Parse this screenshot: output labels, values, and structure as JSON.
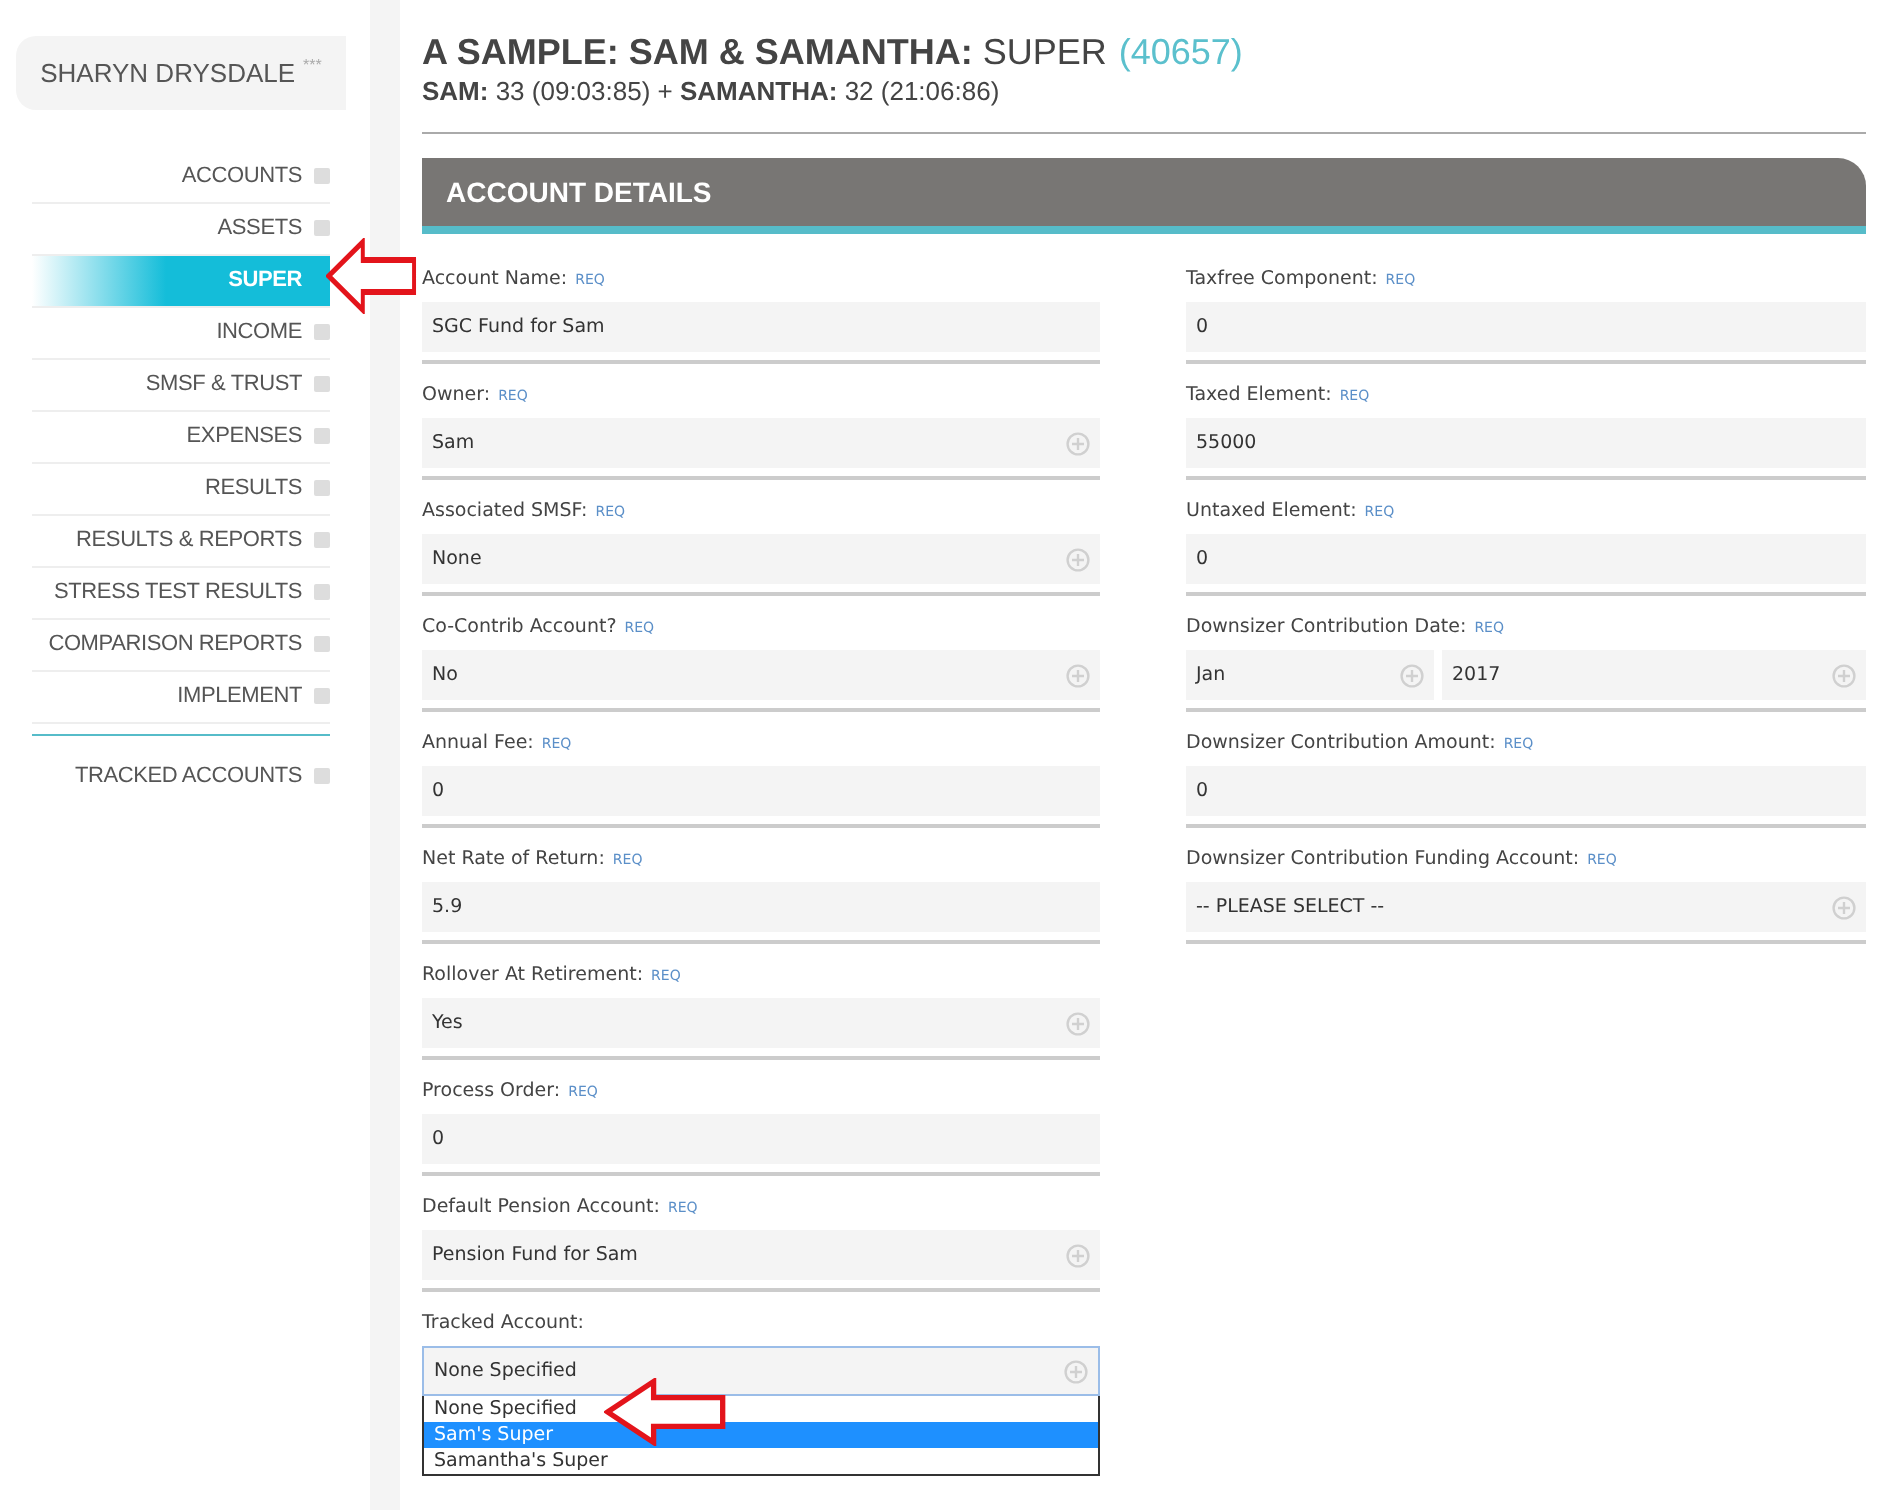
{
  "sidebar": {
    "user": "SHARYN DRYSDALE",
    "user_badge": "***",
    "items": [
      {
        "label": "ACCOUNTS",
        "selected": false
      },
      {
        "label": "ASSETS",
        "selected": false
      },
      {
        "label": "SUPER",
        "selected": true
      },
      {
        "label": "INCOME",
        "selected": false
      },
      {
        "label": "SMSF & TRUST",
        "selected": false
      },
      {
        "label": "EXPENSES",
        "selected": false
      },
      {
        "label": "RESULTS",
        "selected": false
      },
      {
        "label": "RESULTS & REPORTS",
        "selected": false
      },
      {
        "label": "STRESS TEST RESULTS",
        "selected": false
      },
      {
        "label": "COMPARISON REPORTS",
        "selected": false
      },
      {
        "label": "IMPLEMENT",
        "selected": false
      }
    ],
    "footer_items": [
      {
        "label": "TRACKED ACCOUNTS",
        "selected": false
      }
    ]
  },
  "header": {
    "title": "**A SAMPLE: SAM & SAMANTHA:** SUPER",
    "id": "(40657)",
    "subtitle": "**SAM:** 33 (09:03:85) + **SAMANTHA:** 32 (21:06:86)"
  },
  "panel": {
    "title": "ACCOUNT DETAILS",
    "left_fields": [
      {
        "label": "Account Name:",
        "req": "REQ",
        "kind": "text",
        "values": [
          "SGC Fund for Sam"
        ]
      },
      {
        "label": "Owner:",
        "req": "REQ",
        "kind": "select",
        "values": [
          "Sam"
        ]
      },
      {
        "label": "Associated SMSF:",
        "req": "REQ",
        "kind": "select",
        "values": [
          "None"
        ]
      },
      {
        "label": "Co-Contrib Account?",
        "req": "REQ",
        "kind": "select",
        "values": [
          "No"
        ]
      },
      {
        "label": "Annual Fee:",
        "req": "REQ",
        "kind": "text",
        "values": [
          "0"
        ]
      },
      {
        "label": "Net Rate of Return:",
        "req": "REQ",
        "kind": "text",
        "values": [
          "5.9"
        ]
      },
      {
        "label": "Rollover At Retirement:",
        "req": "REQ",
        "kind": "select",
        "values": [
          "Yes"
        ]
      },
      {
        "label": "Process Order:",
        "req": "REQ",
        "kind": "text",
        "values": [
          "0"
        ]
      },
      {
        "label": "Default Pension Account:",
        "req": "REQ",
        "kind": "select",
        "values": [
          "Pension Fund for Sam"
        ]
      },
      {
        "label": "Tracked Account:",
        "kind": "dropdown",
        "values": [
          "None Specified"
        ],
        "options": [
          {
            "label": "None Specified",
            "selected": false
          },
          {
            "label": "Sam's Super",
            "selected": true
          },
          {
            "label": "Samantha's Super",
            "selected": false
          }
        ]
      }
    ],
    "right_fields": [
      {
        "label": "Taxfree Component:",
        "req": "REQ",
        "kind": "text",
        "values": [
          "0"
        ]
      },
      {
        "label": "Taxed Element:",
        "req": "REQ",
        "kind": "text",
        "values": [
          "55000"
        ]
      },
      {
        "label": "Untaxed Element:",
        "req": "REQ",
        "kind": "text",
        "values": [
          "0"
        ]
      },
      {
        "label": "Downsizer Contribution Date:",
        "req": "REQ",
        "kind": "date",
        "values": [
          "Jan",
          "2017"
        ]
      },
      {
        "label": "Downsizer Contribution Amount:",
        "req": "REQ",
        "kind": "text",
        "values": [
          "0"
        ]
      },
      {
        "label": "Downsizer Contribution Funding Account:",
        "req": "REQ",
        "kind": "select",
        "values": [
          "-- PLEASE SELECT --"
        ]
      }
    ]
  },
  "annotation_arrows": [
    {
      "kind": "arrow"
    },
    {
      "kind": "arrow"
    }
  ]
}
